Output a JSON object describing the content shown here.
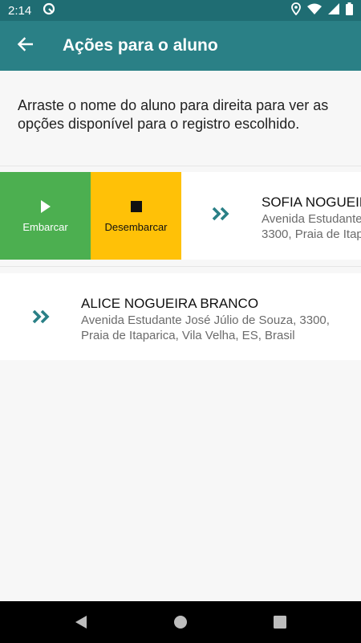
{
  "status_bar": {
    "time": "2:14",
    "icons": [
      "app-notification-icon",
      "location-icon",
      "wifi-icon",
      "signal-icon",
      "battery-icon"
    ]
  },
  "app_bar": {
    "title": "Ações para o aluno",
    "back_icon": "arrow-back-icon",
    "color": "#2a8086"
  },
  "instruction": {
    "text": "Arraste o nome do aluno para direita para ver as opções disponível para o registro escolhido."
  },
  "actions": {
    "embarcar": {
      "label": "Embarcar",
      "icon": "play-icon",
      "color": "#4caf50"
    },
    "desembarcar": {
      "label": "Desembarcar",
      "icon": "stop-icon",
      "color": "#ffc107"
    }
  },
  "students": [
    {
      "name": "SOFIA NOGUEIR",
      "address_line1": "Avenida Estudante",
      "address_line2": "3300, Praia de Itap",
      "icon": "double-chevron-right-icon"
    },
    {
      "name": "ALICE NOGUEIRA BRANCO",
      "address": "Avenida Estudante José Júlio de Souza, 3300, Praia de Itaparica, Vila Velha, ES, Brasil",
      "icon": "double-chevron-right-icon"
    }
  ],
  "nav_bar": {
    "icons": [
      "back-triangle-icon",
      "home-circle-icon",
      "recents-square-icon"
    ]
  }
}
